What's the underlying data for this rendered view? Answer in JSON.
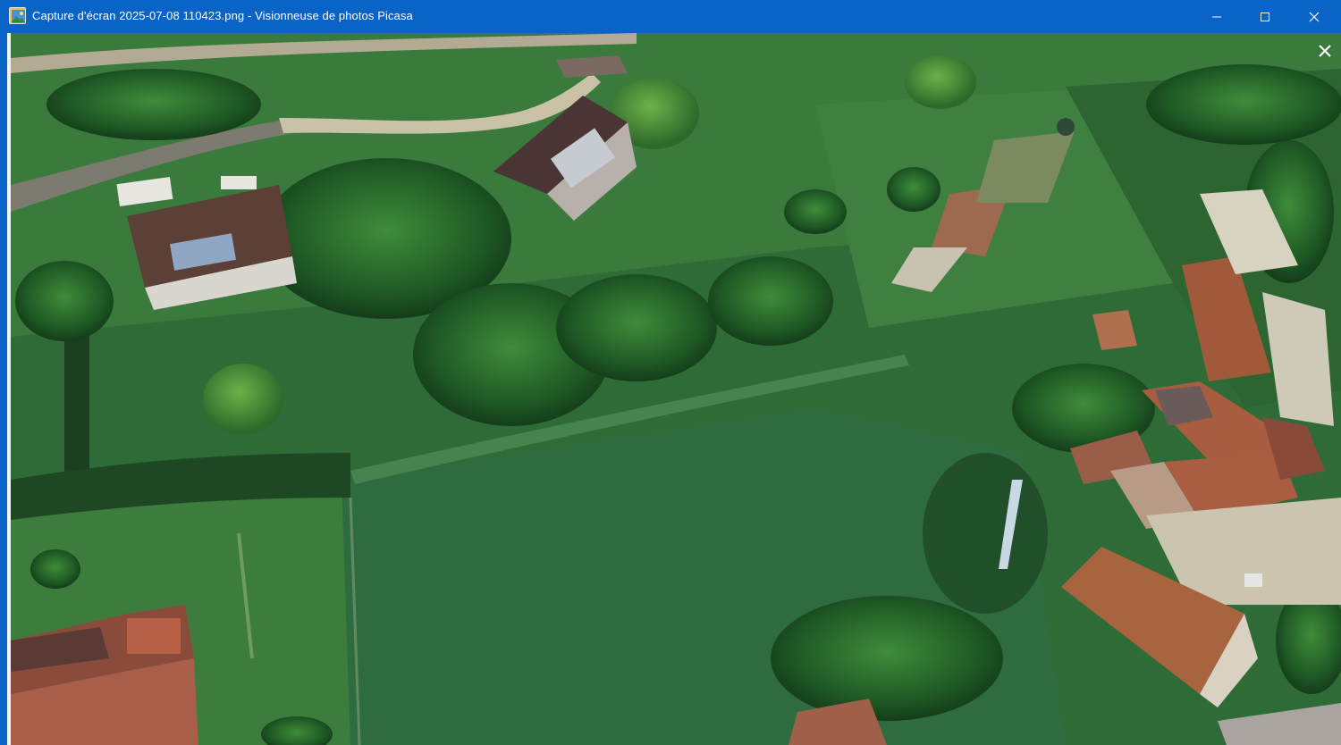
{
  "window": {
    "title": "Capture d'écran 2025-07-08 110423.png - Visionneuse de photos Picasa",
    "app_icon": "image-icon",
    "controls": {
      "minimize": "minimize-icon",
      "maximize": "maximize-icon",
      "close": "close-icon"
    },
    "accent_color": "#0a64c8"
  },
  "viewer": {
    "close_overlay_icon": "close-icon",
    "photo_subject": "aerial-view-photo"
  }
}
